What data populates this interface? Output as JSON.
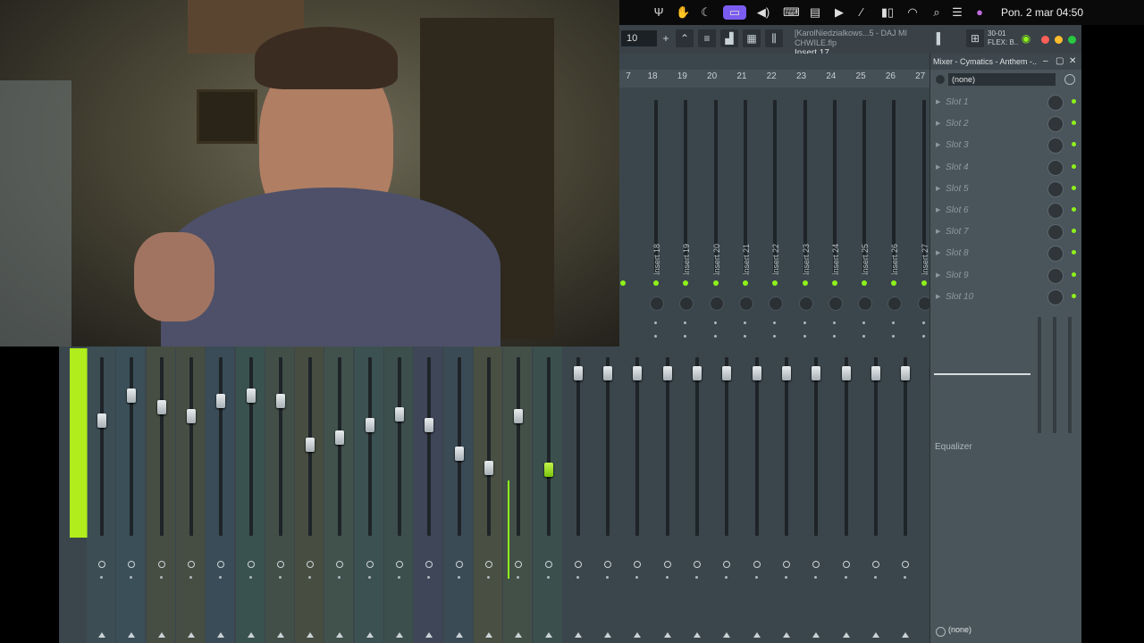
{
  "menubar": {
    "clock": "Pon. 2 mar  04:50",
    "icons": [
      "fl-studio-icon",
      "hand-icon",
      "moon-icon",
      "screen-mirror-icon",
      "volume-icon",
      "keyboard-icon",
      "stage-manager-icon",
      "play-icon",
      "mute-icon",
      "battery-icon",
      "wifi-icon",
      "search-icon",
      "control-center-icon",
      "siri-icon"
    ]
  },
  "toolbar": {
    "pattern": "10",
    "hint_line1": "[KarolNiedzialkows...5 - DAJ MI CHWILE.flp",
    "hint_line2": "Insert 17",
    "flex_line1": "30-01",
    "flex_line2": "FLEX: B.."
  },
  "mixer": {
    "track_numbers": [
      "7",
      "18",
      "19",
      "20",
      "21",
      "22",
      "23",
      "24",
      "25",
      "26",
      "27"
    ],
    "insert_labels": [
      "Insert 18",
      "Insert 19",
      "Insert 20",
      "Insert 21",
      "Insert 22",
      "Insert 23",
      "Insert 24",
      "Insert 25",
      "Insert 26",
      "Insert 27"
    ]
  },
  "fx_panel": {
    "title": "Mixer - Cymatics - Anthem -..",
    "input": "(none)",
    "slots": [
      "Slot 1",
      "Slot 2",
      "Slot 3",
      "Slot 4",
      "Slot 5",
      "Slot 6",
      "Slot 7",
      "Slot 8",
      "Slot 9",
      "Slot 10"
    ],
    "eq_label": "Equalizer",
    "output": "(none)"
  },
  "colors": {
    "accent_green": "#8ef21a",
    "mixer_bg": "#3b464c",
    "active_icon": "#7b5cf0"
  }
}
